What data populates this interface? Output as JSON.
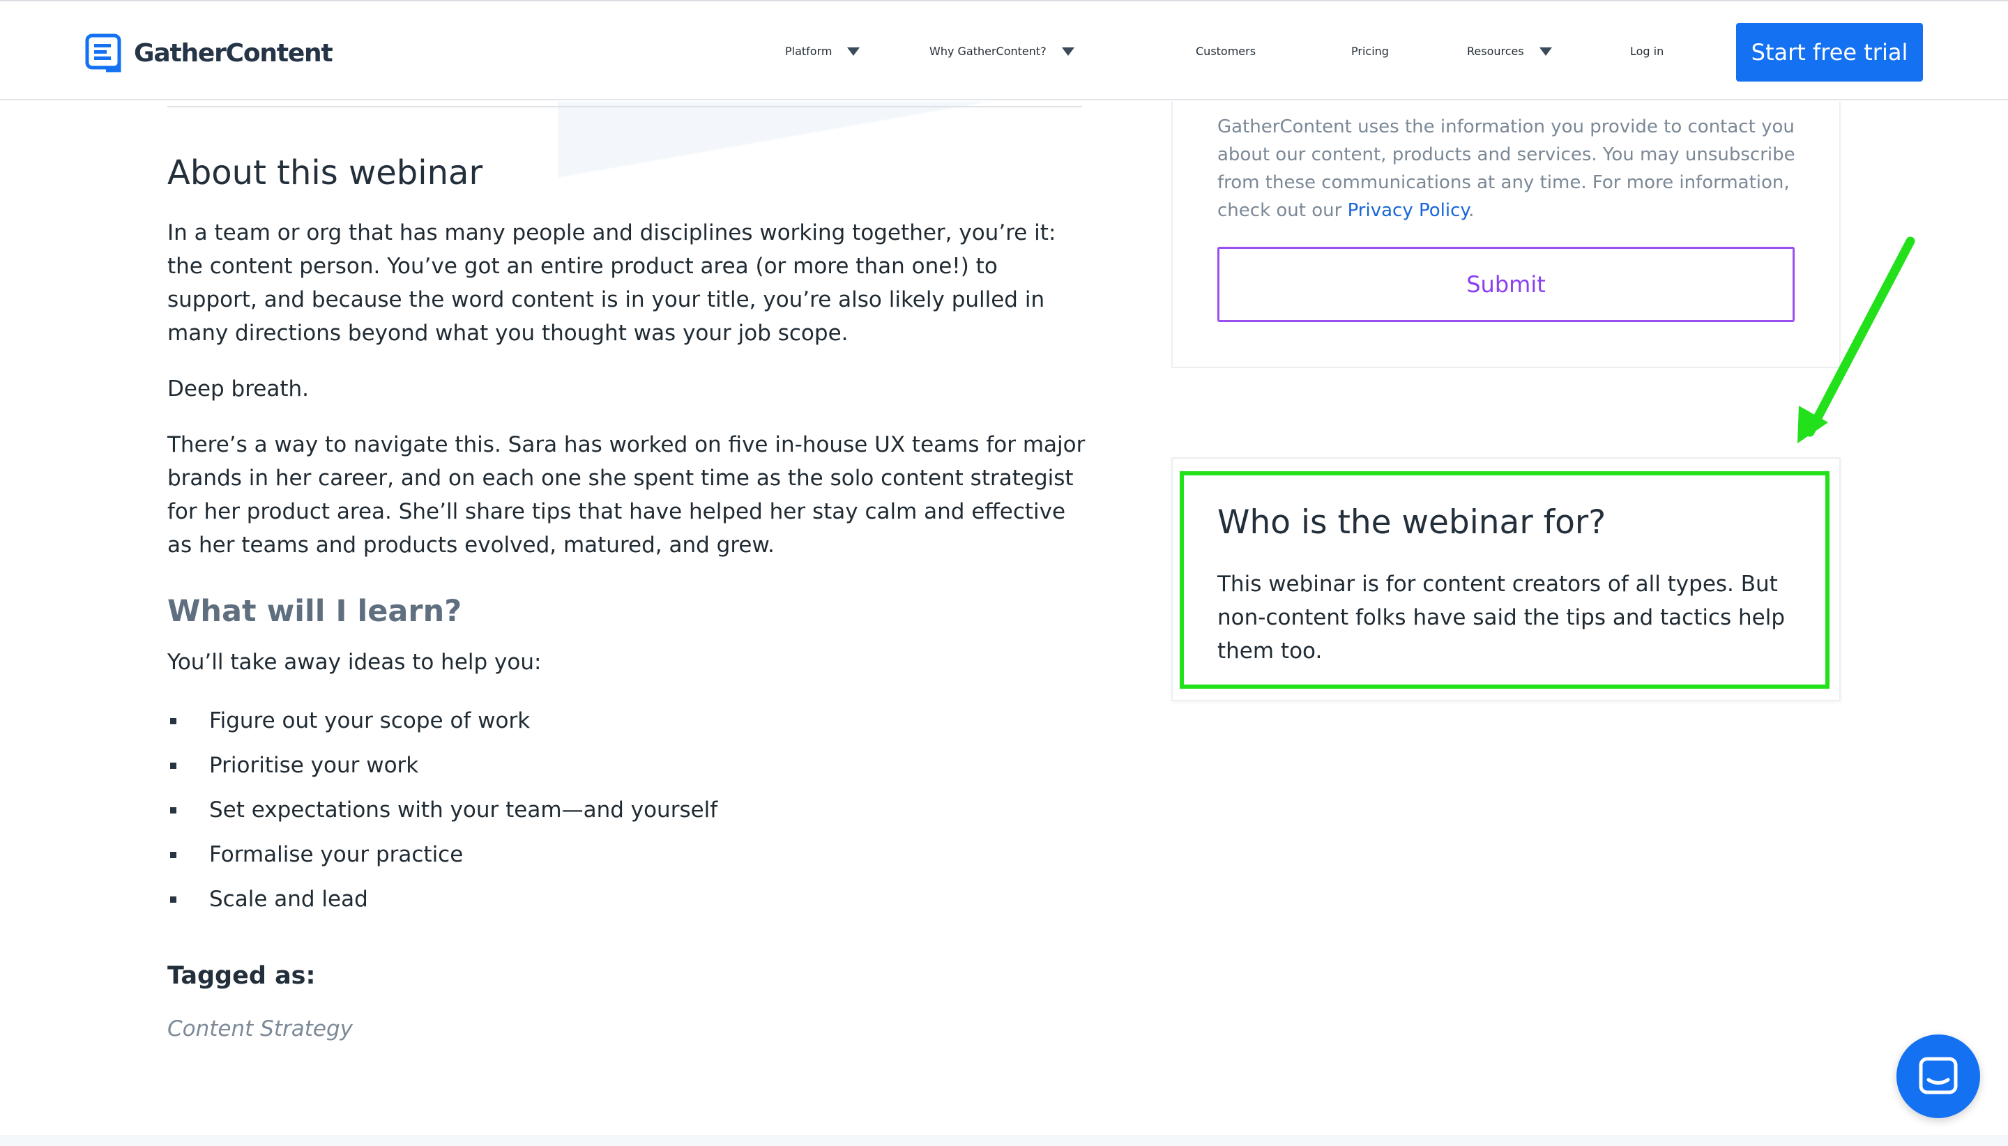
{
  "brand": {
    "name": "GatherContent",
    "accent": "#1371f2",
    "highlight": "#22e01a"
  },
  "nav": {
    "items": [
      {
        "label": "Platform",
        "dropdown": true
      },
      {
        "label": "Why GatherContent?",
        "dropdown": true
      },
      {
        "label": "Customers",
        "dropdown": false
      },
      {
        "label": "Pricing",
        "dropdown": false
      },
      {
        "label": "Resources",
        "dropdown": true
      },
      {
        "label": "Log in",
        "dropdown": false
      }
    ],
    "cta": "Start free trial"
  },
  "about": {
    "heading": "About this webinar",
    "p1": "In a team or org that has many people and disciplines working together, you’re it: the content person. You’ve got an entire product area (or more than one!) to support, and because the word content is in your title, you’re also likely pulled in many directions beyond what you thought was your job scope.",
    "p2": "Deep breath.",
    "p3": "There’s a way to navigate this. Sara has worked on five in-house UX teams for major brands in her career, and on each one she spent time as the solo content strategist for her product area. She’ll share tips that have helped her stay calm and effective as her teams and products evolved, matured, and grew."
  },
  "learn": {
    "heading": "What will I learn?",
    "intro": "You’ll take away ideas to help you:",
    "items": [
      "Figure out your scope of work",
      "Prioritise your work",
      "Set expectations with your team—and yourself",
      "Formalise your practice",
      "Scale and lead"
    ]
  },
  "tags": {
    "label": "Tagged as:",
    "items": [
      "Content Strategy"
    ]
  },
  "form": {
    "privacy_text": "GatherContent uses the information you provide to contact you about our content, products and services. You may unsubscribe from these communications at any time. For more information, check out our ",
    "privacy_link": "Privacy Policy",
    "privacy_end": ".",
    "submit": "Submit"
  },
  "who": {
    "heading": "Who is the webinar for?",
    "text": "This webinar is for content creators of all types. But non-content folks have said the tips and tactics help them too."
  },
  "icons": {
    "logo": "gathercontent-logo-icon",
    "chat": "chat-bubble-icon",
    "arrow": "green-arrow-annotation"
  }
}
